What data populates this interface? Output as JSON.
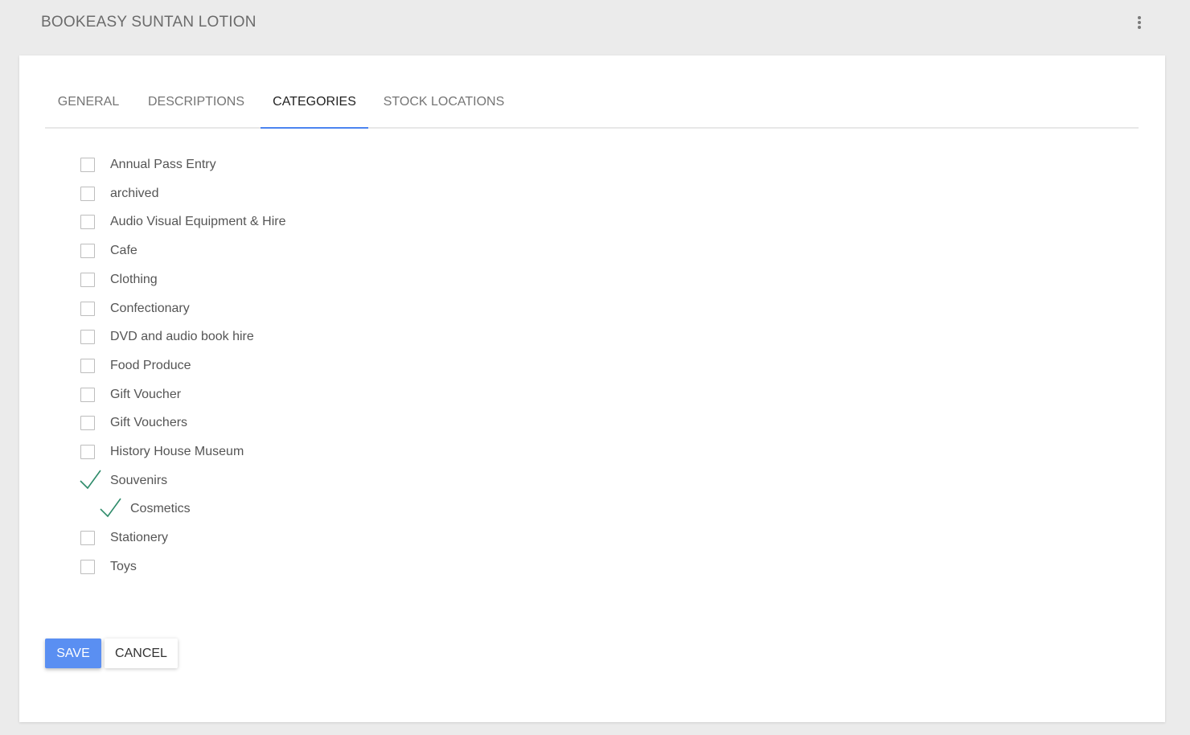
{
  "header": {
    "title": "BOOKEASY SUNTAN LOTION",
    "menu_icon": "more-vert-icon"
  },
  "tabs": [
    {
      "label": "GENERAL",
      "active": false
    },
    {
      "label": "DESCRIPTIONS",
      "active": false
    },
    {
      "label": "CATEGORIES",
      "active": true
    },
    {
      "label": "STOCK LOCATIONS",
      "active": false
    }
  ],
  "categories": [
    {
      "label": "Annual Pass Entry",
      "checked": false,
      "level": 0
    },
    {
      "label": "archived",
      "checked": false,
      "level": 0
    },
    {
      "label": "Audio Visual Equipment & Hire",
      "checked": false,
      "level": 0
    },
    {
      "label": "Cafe",
      "checked": false,
      "level": 0
    },
    {
      "label": "Clothing",
      "checked": false,
      "level": 0
    },
    {
      "label": "Confectionary",
      "checked": false,
      "level": 0
    },
    {
      "label": "DVD and audio book hire",
      "checked": false,
      "level": 0
    },
    {
      "label": "Food Produce",
      "checked": false,
      "level": 0
    },
    {
      "label": "Gift Voucher",
      "checked": false,
      "level": 0
    },
    {
      "label": "Gift Vouchers",
      "checked": false,
      "level": 0
    },
    {
      "label": "History House Museum",
      "checked": false,
      "level": 0
    },
    {
      "label": "Souvenirs",
      "checked": true,
      "level": 0
    },
    {
      "label": "Cosmetics",
      "checked": true,
      "level": 1
    },
    {
      "label": "Stationery",
      "checked": false,
      "level": 0
    },
    {
      "label": "Toys",
      "checked": false,
      "level": 0
    }
  ],
  "actions": {
    "save_label": "SAVE",
    "cancel_label": "CANCEL"
  },
  "colors": {
    "accent": "#4c84f0",
    "save_button": "#5a8ff2",
    "checkmark": "#2e8b6a",
    "background": "#ebebeb",
    "card": "#ffffff"
  }
}
